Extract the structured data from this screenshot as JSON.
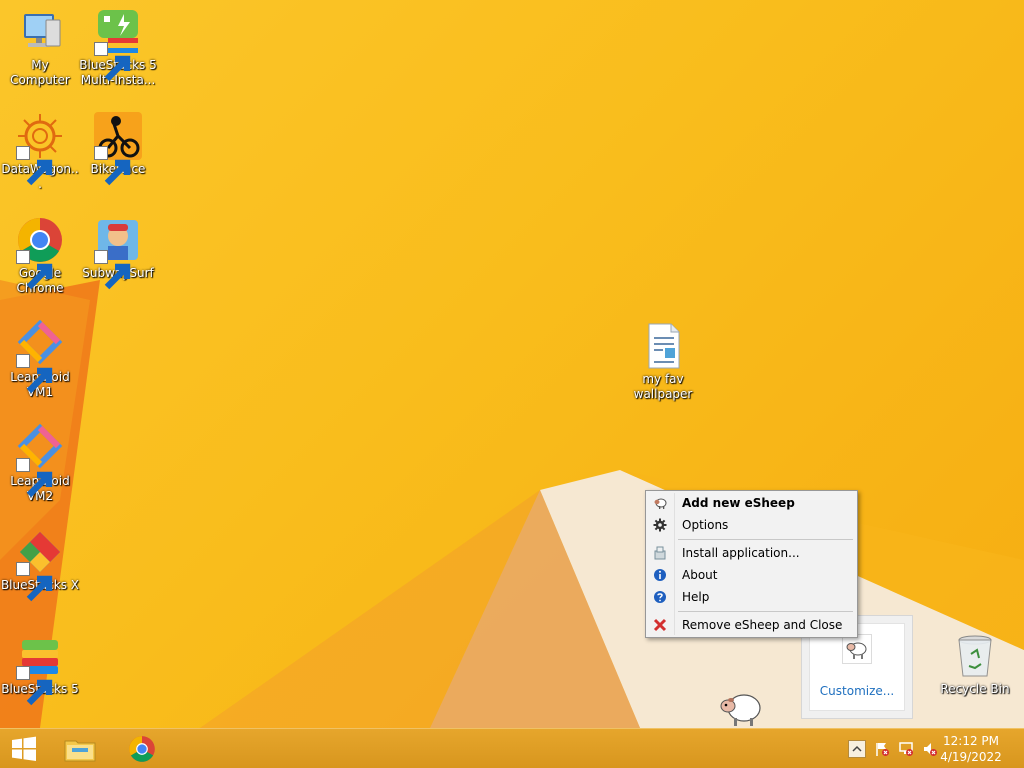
{
  "desktop": {
    "icons": [
      {
        "label": "My Computer",
        "icon": "computer-icon"
      },
      {
        "label": "BlueStacks 5 Multi-Insta...",
        "icon": "bluestacks-multi-instance-icon"
      },
      {
        "label": "DataWagon...",
        "icon": "datawagon-icon"
      },
      {
        "label": "BikeRace",
        "icon": "bikerace-icon"
      },
      {
        "label": "Google Chrome",
        "icon": "chrome-icon"
      },
      {
        "label": "SubwaySurf",
        "icon": "subwaysurf-icon"
      },
      {
        "label": "Leapdroid VM1",
        "icon": "leapdroid-icon"
      },
      {
        "label": "Leapdroid VM2",
        "icon": "leapdroid-icon"
      },
      {
        "label": "BlueStacks X",
        "icon": "bluestacks-x-icon"
      },
      {
        "label": "BlueStacks 5",
        "icon": "bluestacks-icon"
      },
      {
        "label": "my fav wallpaper",
        "icon": "document-icon"
      },
      {
        "label": "Recycle Bin",
        "icon": "recycle-bin-icon"
      }
    ]
  },
  "context_menu": {
    "items": [
      {
        "label": "Add new eSheep",
        "icon": "sheep-icon"
      },
      {
        "label": "Options",
        "icon": "gear-icon"
      },
      {
        "label": "Install application...",
        "icon": "install-icon"
      },
      {
        "label": "About",
        "icon": "info-icon"
      },
      {
        "label": "Help",
        "icon": "help-icon"
      },
      {
        "label": "Remove eSheep and Close",
        "icon": "close-icon"
      }
    ]
  },
  "tray_flyout": {
    "customize_label": "Customize..."
  },
  "taskbar": {
    "clock_time": "12:12 PM",
    "clock_date": "4/19/2022"
  },
  "colors": {
    "wallpaper": "#f9bd1c",
    "taskbar": "#e0a02a",
    "link": "#1e6fbf"
  }
}
